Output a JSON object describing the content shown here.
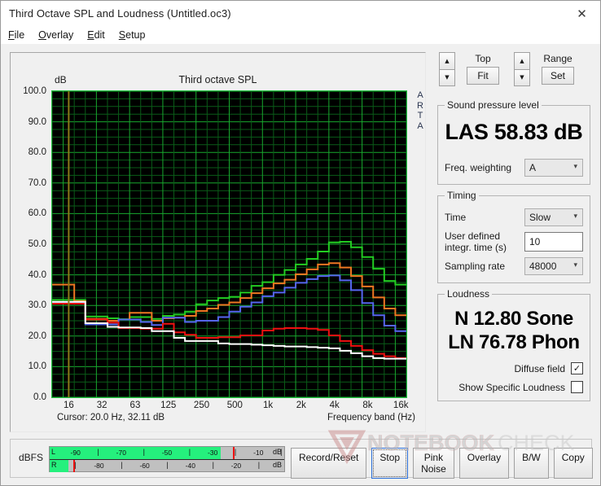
{
  "window": {
    "title": "Third Octave SPL and Loudness (Untitled.oc3)",
    "close_icon": "close-icon",
    "close_glyph": "✕"
  },
  "menu": {
    "items": [
      {
        "label": "File",
        "mnemonic": "F",
        "rest": "ile"
      },
      {
        "label": "Overlay",
        "mnemonic": "O",
        "rest": "verlay"
      },
      {
        "label": "Edit",
        "mnemonic": "E",
        "rest": "dit"
      },
      {
        "label": "Setup",
        "mnemonic": "S",
        "rest": "etup"
      }
    ]
  },
  "chart_panel": {
    "y_unit": "dB",
    "watermark_text": "ARTA",
    "cursor_text": "Cursor:   20.0 Hz, 32.11 dB",
    "frequency_axis_label": "Frequency band (Hz)"
  },
  "chart_data": {
    "type": "line",
    "title": "Third octave SPL",
    "xlabel": "Frequency band (Hz)",
    "ylabel": "dB",
    "ylim": [
      0,
      100
    ],
    "ytick_step": 10,
    "yticks": [
      "0.0",
      "10.0",
      "20.0",
      "30.0",
      "40.0",
      "50.0",
      "60.0",
      "70.0",
      "80.0",
      "90.0",
      "100.0"
    ],
    "xticks": [
      "16",
      "32",
      "63",
      "125",
      "250",
      "500",
      "1k",
      "2k",
      "4k",
      "8k",
      "16k"
    ],
    "grid": true,
    "grid_color": "#0d7a22",
    "plot_bg": "#000000",
    "step_plot": true,
    "cursor_line": {
      "frequency_hz": 20.0,
      "value_db": 32.11,
      "color": "#8a7a18"
    },
    "bands_hz": [
      16,
      20,
      25,
      31.5,
      40,
      50,
      63,
      80,
      100,
      125,
      160,
      200,
      250,
      315,
      400,
      500,
      630,
      800,
      1000,
      1250,
      1600,
      2000,
      2500,
      3150,
      4000,
      5000,
      6300,
      8000,
      10000,
      12500,
      16000,
      20000
    ],
    "series": [
      {
        "name": "green",
        "color": "#22cc22",
        "values": [
          31.8,
          31.8,
          31.8,
          26.4,
          26.4,
          25.8,
          25.5,
          26.2,
          26.2,
          25.6,
          26.6,
          27.0,
          28.0,
          30.4,
          31.6,
          32.4,
          32.8,
          34.2,
          36.4,
          37.6,
          40.0,
          41.6,
          43.4,
          45.2,
          47.6,
          50.6,
          50.8,
          49.0,
          45.8,
          42.0,
          38.0,
          36.8
        ]
      },
      {
        "name": "orange",
        "color": "#ee7722",
        "values": [
          36.8,
          36.8,
          31.4,
          25.6,
          25.6,
          25.0,
          25.4,
          27.6,
          27.6,
          25.0,
          25.8,
          26.0,
          26.6,
          28.2,
          29.0,
          30.2,
          31.0,
          32.4,
          34.0,
          35.6,
          37.2,
          38.4,
          40.2,
          41.8,
          43.4,
          43.8,
          42.4,
          39.6,
          36.2,
          32.6,
          29.0,
          26.8
        ]
      },
      {
        "name": "blue",
        "color": "#5566ee",
        "values": [
          31.0,
          31.0,
          31.0,
          23.8,
          23.8,
          23.8,
          25.4,
          25.4,
          24.6,
          23.6,
          26.0,
          26.0,
          24.6,
          25.0,
          25.0,
          26.2,
          28.0,
          29.6,
          31.0,
          33.0,
          34.2,
          35.8,
          37.4,
          38.6,
          39.6,
          39.8,
          38.2,
          35.0,
          30.8,
          26.8,
          23.4,
          21.6
        ]
      },
      {
        "name": "red",
        "color": "#ee1111",
        "values": [
          30.6,
          30.6,
          30.6,
          25.4,
          25.4,
          24.4,
          22.6,
          22.6,
          22.4,
          22.4,
          24.0,
          21.2,
          20.4,
          19.4,
          19.4,
          19.6,
          19.6,
          20.2,
          20.2,
          21.8,
          22.4,
          22.6,
          22.6,
          22.4,
          22.0,
          20.2,
          18.4,
          16.8,
          15.4,
          14.2,
          13.4,
          12.8
        ]
      },
      {
        "name": "white",
        "color": "#ffffff",
        "values": [
          31.2,
          31.2,
          31.2,
          24.2,
          24.2,
          23.0,
          22.8,
          22.8,
          22.6,
          21.6,
          21.6,
          19.4,
          18.4,
          18.4,
          18.4,
          17.6,
          17.4,
          17.4,
          17.2,
          17.0,
          16.8,
          16.6,
          16.6,
          16.4,
          16.2,
          16.0,
          15.2,
          14.4,
          13.4,
          12.8,
          12.6,
          12.6
        ]
      }
    ]
  },
  "scale_controls": {
    "top": {
      "label": "Top",
      "button": "Fit"
    },
    "range": {
      "label": "Range",
      "button": "Set"
    },
    "up_glyph": "▲",
    "down_glyph": "▼"
  },
  "spl": {
    "group_label": "Sound pressure level",
    "reading": "LAS 58.83 dB",
    "weighting_label": "Freq. weighting",
    "weighting_value": "A"
  },
  "timing": {
    "group_label": "Timing",
    "time_label": "Time",
    "time_value": "Slow",
    "integr_label_line1": "User defined",
    "integr_label_line2": "integr. time (s)",
    "integr_value": "10",
    "sampling_label": "Sampling rate",
    "sampling_value": "48000"
  },
  "loudness": {
    "group_label": "Loudness",
    "sone_line": "N 12.80 Sone",
    "phon_line": "LN 76.78 Phon",
    "diffuse_label": "Diffuse field",
    "diffuse_checked": true,
    "specific_label": "Show Specific Loudness",
    "specific_checked": false,
    "check_glyph": "✓"
  },
  "meter": {
    "label": "dBFS",
    "left_channel": "L",
    "right_channel": "R",
    "unit": "dB",
    "top_ticks": [
      "-90",
      "-70",
      "-50",
      "-30",
      "-10"
    ],
    "bottom_ticks": [
      "-80",
      "-60",
      "-40",
      "-20"
    ],
    "left_fill_percent": 73,
    "right_fill_percent": 8,
    "left_peak_percent": 78,
    "right_peak_percent": 10,
    "fill_color": "#25f07d",
    "peak_color": "#ee1111"
  },
  "transport": {
    "buttons": [
      {
        "label": "Record/Reset",
        "focused": false
      },
      {
        "label": "Stop",
        "focused": true
      },
      {
        "label": "Pink Noise",
        "focused": false
      },
      {
        "label": "Overlay",
        "focused": false
      },
      {
        "label": "B/W",
        "focused": false
      },
      {
        "label": "Copy",
        "focused": false
      }
    ]
  },
  "watermark": {
    "text_bold": "NOTEBOOK",
    "text_light": "CHECK"
  }
}
